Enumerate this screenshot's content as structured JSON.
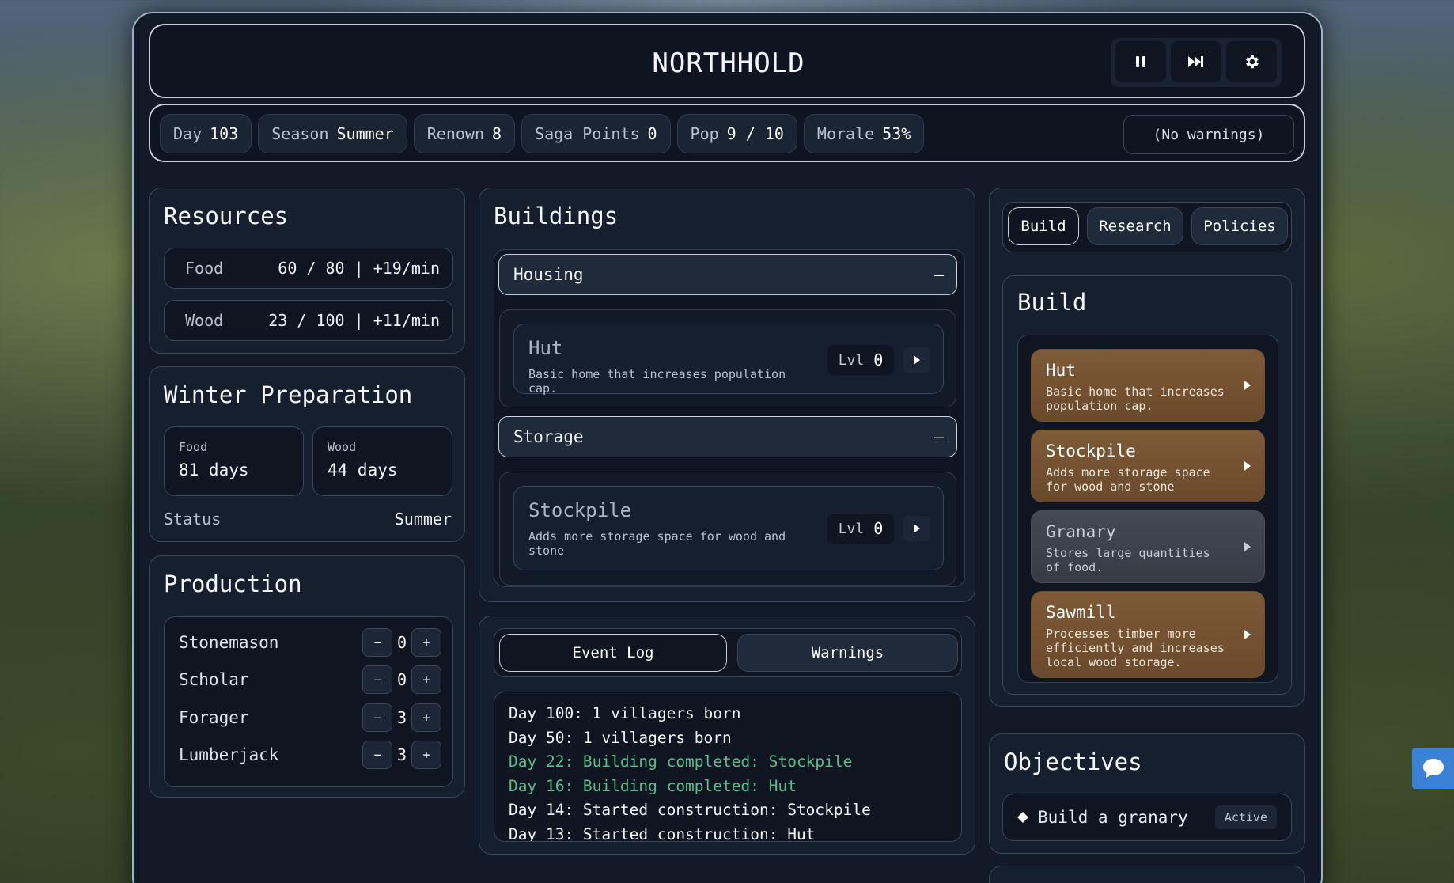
{
  "header": {
    "title": "NORTHHOLD",
    "controls": [
      "pause-icon",
      "fast-forward-icon",
      "gear-icon"
    ]
  },
  "stats": [
    {
      "key": "Day",
      "value": "103"
    },
    {
      "key": "Season",
      "value": "Summer"
    },
    {
      "key": "Renown",
      "value": "8"
    },
    {
      "key": "Saga Points",
      "value": "0"
    },
    {
      "key": "Pop",
      "value": "9 / 10"
    },
    {
      "key": "Morale",
      "value": "53%"
    }
  ],
  "warnings_summary": "(No warnings)",
  "resources": {
    "title": "Resources",
    "items": [
      {
        "label": "Food",
        "value": "60 / 80 | +19/min"
      },
      {
        "label": "Wood",
        "value": "23 / 100 | +11/min"
      }
    ]
  },
  "winter": {
    "title": "Winter Preparation",
    "boxes": [
      {
        "label": "Food",
        "value": "81 days"
      },
      {
        "label": "Wood",
        "value": "44 days"
      }
    ],
    "status_label": "Status",
    "status_value": "Summer"
  },
  "production": {
    "title": "Production",
    "rows": [
      {
        "name": "Stonemason",
        "count": "0"
      },
      {
        "name": "Scholar",
        "count": "0"
      },
      {
        "name": "Forager",
        "count": "3"
      },
      {
        "name": "Lumberjack",
        "count": "3"
      }
    ],
    "minus": "−",
    "plus": "+"
  },
  "buildings": {
    "title": "Buildings",
    "collapse_symbol": "—",
    "level_label": "Lvl",
    "groups": [
      {
        "name": "Housing",
        "items": [
          {
            "name": "Hut",
            "desc": "Basic home that increases population cap.",
            "level": "0"
          }
        ]
      },
      {
        "name": "Storage",
        "items": [
          {
            "name": "Stockpile",
            "desc": "Adds more storage space for wood and stone",
            "level": "0"
          }
        ]
      }
    ]
  },
  "log": {
    "tabs": [
      "Event Log",
      "Warnings"
    ],
    "entries": [
      {
        "text": "Day 100: 1 villagers born",
        "type": "normal"
      },
      {
        "text": "Day 50: 1 villagers born",
        "type": "normal"
      },
      {
        "text": "Day 22: Building completed: Stockpile",
        "type": "success"
      },
      {
        "text": "Day 16: Building completed: Hut",
        "type": "success"
      },
      {
        "text": "Day 14: Started construction: Stockpile",
        "type": "normal"
      },
      {
        "text": "Day 13: Started construction: Hut",
        "type": "normal"
      }
    ]
  },
  "side_tabs": [
    "Build",
    "Research",
    "Policies"
  ],
  "build": {
    "title": "Build",
    "options": [
      {
        "name": "Hut",
        "desc": "Basic home that increases population cap.",
        "affordable": true
      },
      {
        "name": "Stockpile",
        "desc": "Adds more storage space for wood and stone",
        "affordable": true
      },
      {
        "name": "Granary",
        "desc": "Stores large quantities of food.",
        "affordable": false
      },
      {
        "name": "Sawmill",
        "desc": "Processes timber more efficiently and increases local wood storage.",
        "affordable": true
      }
    ]
  },
  "objectives": {
    "title": "Objectives",
    "items": [
      {
        "text": "Build a granary",
        "status": "Active"
      }
    ]
  },
  "colors": {
    "success": "#5bbf8a",
    "build_card": "#7a5634",
    "build_card_disabled": "#3c414a"
  }
}
